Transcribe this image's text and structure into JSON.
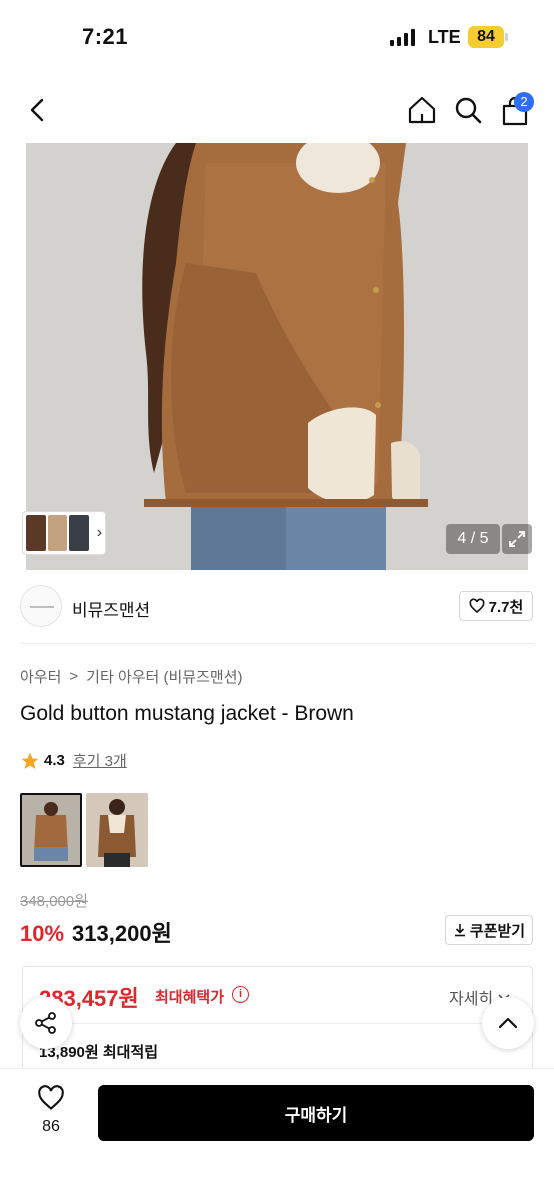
{
  "status_bar": {
    "time": "7:21",
    "network": "LTE",
    "battery": "84"
  },
  "nav": {
    "cart_count": "2"
  },
  "hero": {
    "counter": "4 / 5"
  },
  "brand": {
    "name": "비뮤즈맨션",
    "likes": "7.7천"
  },
  "breadcrumb": {
    "level1": "아우터",
    "separator": ">",
    "level2": "기타 아우터 (비뮤즈맨션)"
  },
  "product": {
    "title": "Gold button mustang jacket - Brown",
    "rating": "4.3",
    "reviews_label": "후기 3개",
    "original_price": "348,000원",
    "discount": "10%",
    "price": "313,200원",
    "coupon_label": "쿠폰받기"
  },
  "benefit": {
    "best_price": "283,457원",
    "best_price_label": "최대혜택가",
    "info_symbol": "i",
    "detail_label": "자세히",
    "points": "13,890원 최대적립"
  },
  "bottom_bar": {
    "wish_count": "86",
    "buy_label": "구매하기"
  },
  "colors": {
    "accent_red": "#e0262d",
    "badge_blue": "#2f6df6",
    "battery_yellow": "#f5cd2f",
    "star": "#f5a623"
  }
}
